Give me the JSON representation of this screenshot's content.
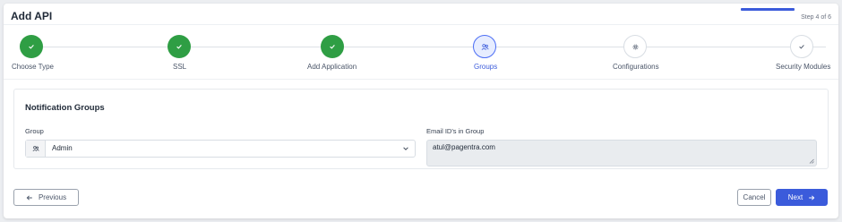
{
  "header": {
    "title": "Add API",
    "step_count": "Step 4 of 6",
    "progress": 0.667
  },
  "stepper": {
    "steps": [
      {
        "label": "Choose Type",
        "state": "done"
      },
      {
        "label": "SSL",
        "state": "done"
      },
      {
        "label": "Add Application",
        "state": "done"
      },
      {
        "label": "Groups",
        "state": "active"
      },
      {
        "label": "Configurations",
        "state": "todo"
      },
      {
        "label": "Security Modules",
        "state": "todo"
      }
    ]
  },
  "form": {
    "section_title": "Notification Groups",
    "group_label": "Group",
    "group_value": "Admin",
    "email_label": "Email ID's in Group",
    "email_value": "atul@pagentra.com"
  },
  "footer": {
    "previous_label": "Previous",
    "cancel_label": "Cancel",
    "next_label": "Next"
  },
  "colors": {
    "accent": "#3b5bdb",
    "success": "#2f9e44"
  }
}
